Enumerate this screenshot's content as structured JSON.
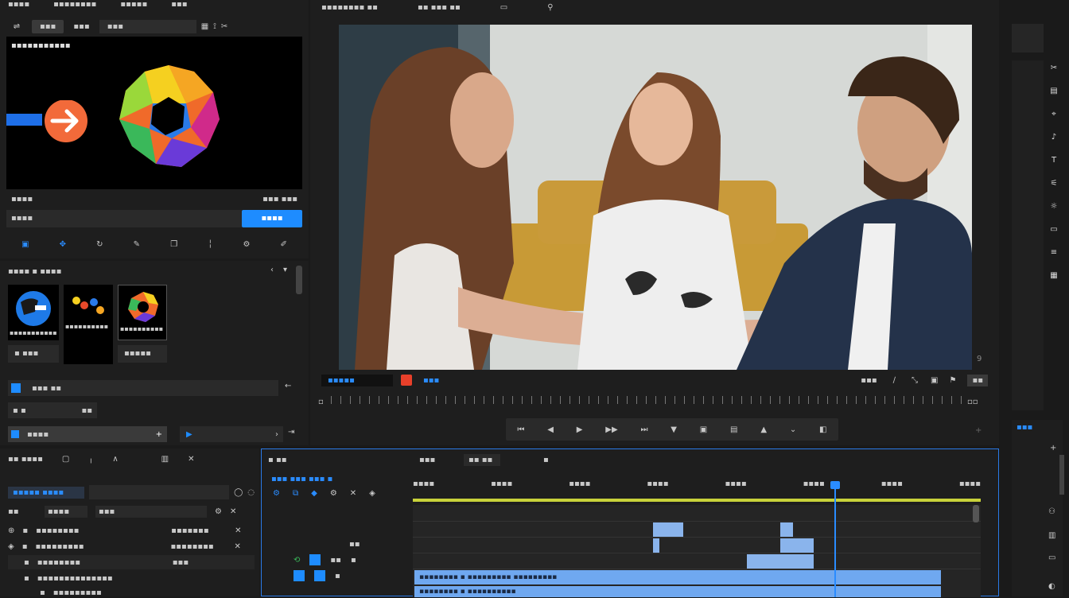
{
  "app": {
    "menu": [
      "▪▪▪▪",
      "▪▪▪▪▪▪▪▪",
      "▪▪▪▪▪",
      "▪▪▪"
    ]
  },
  "source_panel": {
    "tabs": [
      "▪▪▪",
      "▪▪▪",
      "▪▪▪"
    ],
    "preview_title": "▪▪▪▪▪▪▪▪▪▪▪",
    "info_left": "▪▪▪▪",
    "info_right": "▪▪▪ ▪▪▪",
    "name_field": "▪▪▪▪",
    "apply_button": "▪▪▪▪",
    "tools": [
      "▪▪",
      "",
      "",
      "",
      "▪▪",
      "",
      "▪▪"
    ]
  },
  "library": {
    "title": "▪▪▪▪ ▪ ▪▪▪▪",
    "items": [
      {
        "label": "▪▪▪▪▪▪▪▪▪▪▪",
        "sub": "▪ ▪▪▪"
      },
      {
        "label": "▪▪▪▪▪▪▪▪▪▪",
        "sub": ""
      },
      {
        "label": "▪▪▪▪▪▪▪▪▪▪",
        "sub": "▪▪▪▪▪"
      }
    ],
    "row1": "▪▪▪ ▪▪",
    "row2_left": "▪ ▪",
    "row2_right": "▪▪",
    "row3": "▪▪▪▪"
  },
  "program": {
    "header": [
      "▪▪▪▪▪▪▪▪ ▪▪",
      "▪▪ ▪▪▪ ▪▪"
    ],
    "timecode": "▪▪▪▪▪",
    "duration": "▪▪▪",
    "right_labels": [
      "▪▪▪",
      "▪▪"
    ],
    "transport": [
      "⏮",
      "◀",
      "▶",
      "▶▶",
      "⏭",
      "▼",
      "▣",
      "▤",
      "▲",
      "⌄",
      "◧"
    ]
  },
  "project": {
    "title": "▪▪ ▪▪▪▪",
    "search_placeholder": "▪▪▪▪▪ ▪▪▪▪",
    "columns": [
      "▪▪",
      "▪▪▪▪",
      "▪▪▪"
    ],
    "rows": [
      {
        "name": "▪▪▪▪▪▪▪▪",
        "value": "▪▪▪▪▪▪▪"
      },
      {
        "name": "▪▪▪▪▪▪▪▪▪",
        "value": "▪▪▪▪▪▪▪▪"
      },
      {
        "name": "▪▪▪▪▪▪▪▪",
        "value": "▪▪▪"
      },
      {
        "name": "▪▪▪▪▪▪▪▪▪▪▪▪▪▪",
        "value": ""
      },
      {
        "name": "▪▪▪▪▪▪▪▪▪",
        "value": ""
      }
    ]
  },
  "timeline": {
    "title": "▪ ▪▪",
    "tabs": [
      "▪▪▪",
      "▪▪ ▪▪",
      "▪"
    ],
    "sequence": "▪▪▪ ▪▪▪ ▪▪▪ ▪",
    "ruler": [
      "▪▪▪▪",
      "▪▪▪▪",
      "▪▪▪▪",
      "▪▪▪▪",
      "▪▪▪▪",
      "▪▪▪▪",
      "▪▪▪▪",
      "▪▪▪▪"
    ],
    "track_labels": [
      "▪▪",
      "▪▪",
      "▪",
      "▪"
    ],
    "clip1": "▪▪▪▪▪▪▪▪ ▪ ▪▪▪▪▪▪▪▪▪ ▪▪▪▪▪▪▪▪▪",
    "clip2": "▪▪▪▪▪▪▪▪ ▪ ▪▪▪▪▪▪▪▪▪▪"
  },
  "right_bar": {
    "label": "▪▪▪"
  },
  "colors": {
    "accent": "#1e8cff",
    "playhead": "#2a8cff",
    "clip": "#6fa8f0",
    "work_area": "#c8d23a"
  }
}
